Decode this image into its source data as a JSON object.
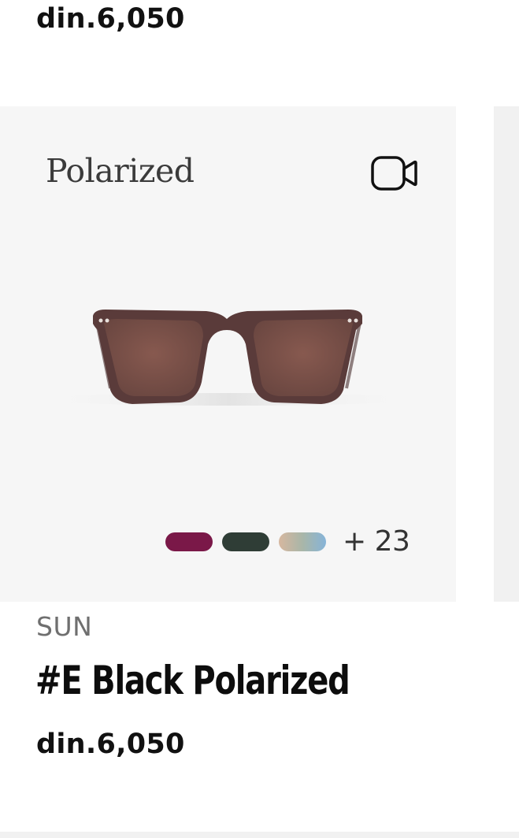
{
  "previous_product": {
    "price": "din.6,050"
  },
  "product": {
    "badge": "Polarized",
    "video_icon": "video-camera-icon",
    "image_alt": "sunglasses",
    "swatches": [
      {
        "name": "burgundy",
        "color": "#7a1848"
      },
      {
        "name": "dark-green",
        "color": "#2f3d36"
      },
      {
        "name": "tortoise-blue-gradient",
        "color": "#b8b8b0"
      }
    ],
    "more_colors": "+ 23",
    "category": "SUN",
    "name": "#E Black Polarized",
    "price": "din.6,050",
    "frame_color": "#5a3b3a",
    "lens_color": "#7a5148"
  }
}
